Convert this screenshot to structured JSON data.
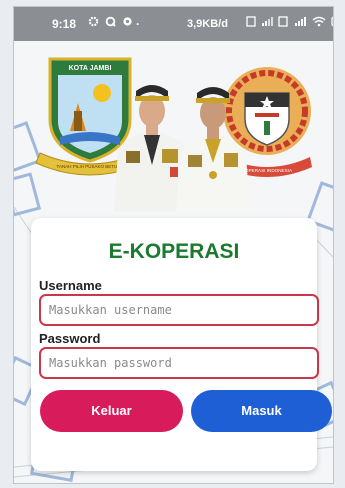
{
  "status_bar": {
    "time": "9:18",
    "dot": "·",
    "network_speed": "3,9KB/d",
    "icons_left": [
      "gear-icon",
      "circle-icon",
      "settings-icon"
    ],
    "icons_right": [
      "sim-icon",
      "signal-icon",
      "sim-icon-2",
      "signal-4g-icon",
      "wifi-icon",
      "battery-icon"
    ]
  },
  "header": {
    "left_emblem_text": "KOTA JAMBI",
    "left_emblem_ribbon": "TANAH PILIH PUSAKO BETUAH",
    "right_emblem_ribbon": "KOPERASI INDONESIA"
  },
  "login": {
    "title": "E-KOPERASI",
    "username_label": "Username",
    "username_placeholder": "Masukkan username",
    "password_label": "Password",
    "password_placeholder": "Masukkan password",
    "keluar_label": "Keluar",
    "masuk_label": "Masuk"
  },
  "colors": {
    "title": "#1b7a2e",
    "input_border": "#c9374a",
    "keluar": "#d81b5a",
    "masuk": "#1f5fd6"
  }
}
